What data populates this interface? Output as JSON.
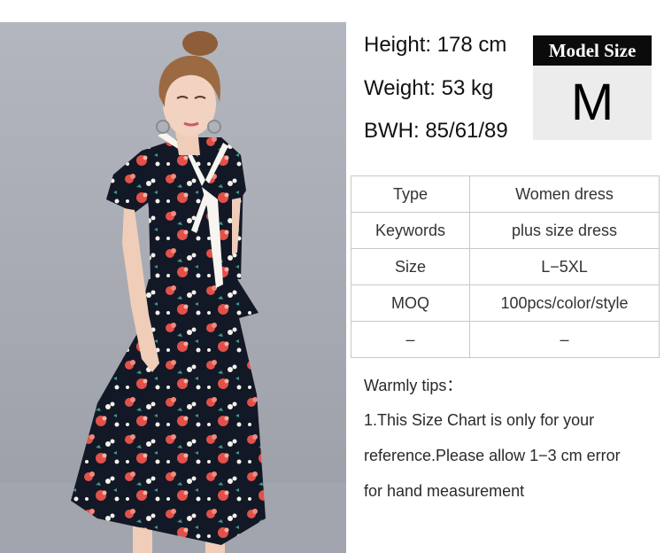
{
  "model": {
    "height": "Height: 178 cm",
    "weight": "Weight: 53 kg",
    "bwh": "BWH: 85/61/89",
    "size_label": "Model Size",
    "size_value": "M"
  },
  "specs": [
    {
      "key": "Type",
      "value": "Women dress"
    },
    {
      "key": "Keywords",
      "value": "plus size dress"
    },
    {
      "key": "Size",
      "value": "L−5XL"
    },
    {
      "key": "MOQ",
      "value": "100pcs/color/style"
    },
    {
      "key": "–",
      "value": "–"
    }
  ],
  "tips": {
    "heading": "Warmly tips：",
    "lines": [
      "1.This Size Chart is only for your",
      "reference.Please allow 1−3 cm error",
      "for hand measurement"
    ]
  },
  "colors": {
    "dress": "#121826",
    "print_red": "#e2504a",
    "print_white": "#f4f1ea",
    "backdrop": "#a9acb4"
  }
}
